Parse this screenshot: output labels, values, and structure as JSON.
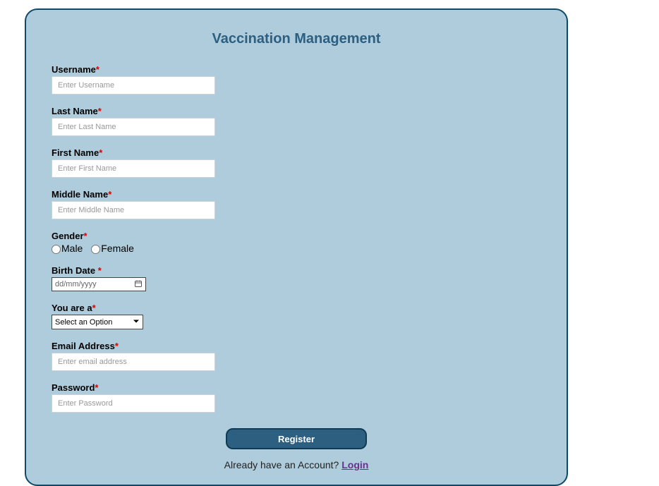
{
  "title": "Vaccination Management",
  "fields": {
    "username": {
      "label": "Username",
      "placeholder": "Enter Username"
    },
    "lastName": {
      "label": "Last Name",
      "placeholder": "Enter Last Name"
    },
    "firstName": {
      "label": "First Name",
      "placeholder": "Enter First Name"
    },
    "middleName": {
      "label": "Middle Name",
      "placeholder": "Enter Middle Name"
    },
    "gender": {
      "label": "Gender",
      "option1": "Male",
      "option2": "Female"
    },
    "birthDate": {
      "label": "Birth Date ",
      "placeholder": "dd/mm/yyyy"
    },
    "youAreA": {
      "label": "You are a",
      "selected": "Select an Option"
    },
    "email": {
      "label": "Email Address",
      "placeholder": "Enter email address"
    },
    "password": {
      "label": "Password",
      "placeholder": "Enter Password"
    }
  },
  "requiredMark": "*",
  "submitLabel": "Register",
  "footer": {
    "prompt": "Already have an Account? ",
    "link": "Login"
  }
}
